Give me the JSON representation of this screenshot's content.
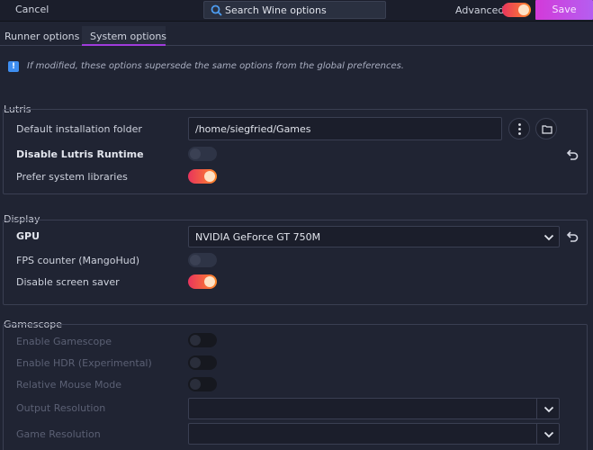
{
  "header": {
    "cancel_label": "Cancel",
    "search_placeholder": "Search Wine options",
    "advanced_label": "Advanced",
    "advanced_on": true,
    "save_label": "Save"
  },
  "tabs": [
    {
      "label": "Runner options",
      "active": false
    },
    {
      "label": "System options",
      "active": true
    }
  ],
  "notice": "If modified, these options supersede the same options from the global preferences.",
  "sections": {
    "lutris": {
      "title": "Lutris",
      "default_folder_label": "Default installation folder",
      "default_folder_value": "/home/siegfried/Games",
      "disable_runtime_label": "Disable Lutris Runtime",
      "disable_runtime_on": false,
      "prefer_system_libs_label": "Prefer system libraries",
      "prefer_system_libs_on": true
    },
    "display": {
      "title": "Display",
      "gpu_label": "GPU",
      "gpu_value": "NVIDIA GeForce GT 750M",
      "fps_label": "FPS counter (MangoHud)",
      "fps_on": false,
      "disable_screensaver_label": "Disable screen saver",
      "disable_screensaver_on": true
    },
    "gamescope": {
      "title": "Gamescope",
      "enable_label": "Enable Gamescope",
      "hdr_label": "Enable HDR (Experimental)",
      "relative_mouse_label": "Relative Mouse Mode",
      "output_resolution_label": "Output Resolution",
      "game_resolution_label": "Game Resolution"
    }
  },
  "colors": {
    "background": "#202433",
    "accent": "#a03cdc",
    "switch_on": "#e8345d",
    "save_button": "#d33ad9"
  }
}
